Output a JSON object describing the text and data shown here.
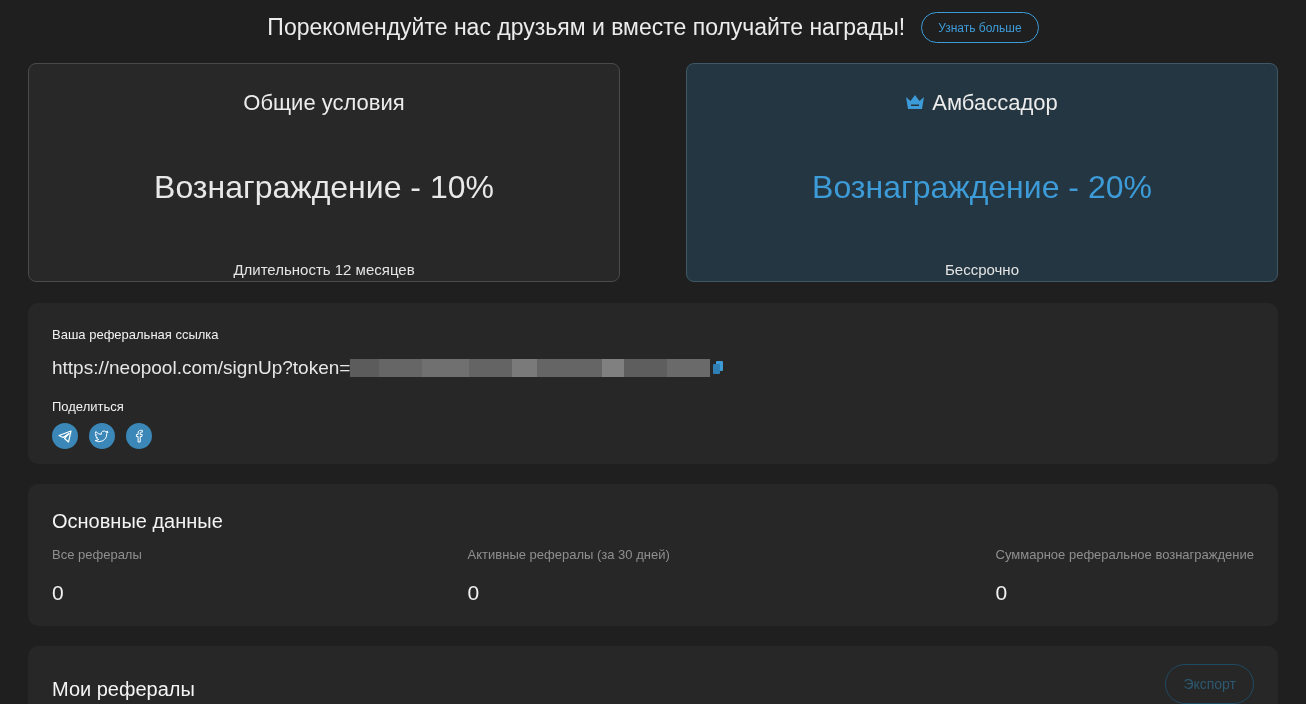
{
  "banner": {
    "text": "Порекомендуйте нас друзьям и вместе получайте награды!",
    "button": "Узнать больше"
  },
  "plans": [
    {
      "kind": "basic",
      "title": "Общие условия",
      "reward": "Вознаграждение - 10%",
      "duration": "Длительность 12 месяцев"
    },
    {
      "kind": "ambassador",
      "title": "Амбассадор",
      "reward": "Вознаграждение - 20%",
      "duration": "Бессрочно"
    }
  ],
  "referral_link": {
    "label": "Ваша реферальная ссылка",
    "url": "https://neopool.com/signUp?token=",
    "share_label": "Поделиться"
  },
  "overview": {
    "title": "Основные данные",
    "stats": [
      {
        "label": "Все рефералы",
        "value": "0"
      },
      {
        "label": "Активные рефералы (за 30 дней)",
        "value": "0"
      },
      {
        "label": "Суммарное реферальное вознаграждение",
        "value": "0"
      }
    ]
  },
  "my_referrals": {
    "title": "Мои рефералы",
    "export_button": {
      "label": "Экспорт",
      "disabled": true
    }
  }
}
